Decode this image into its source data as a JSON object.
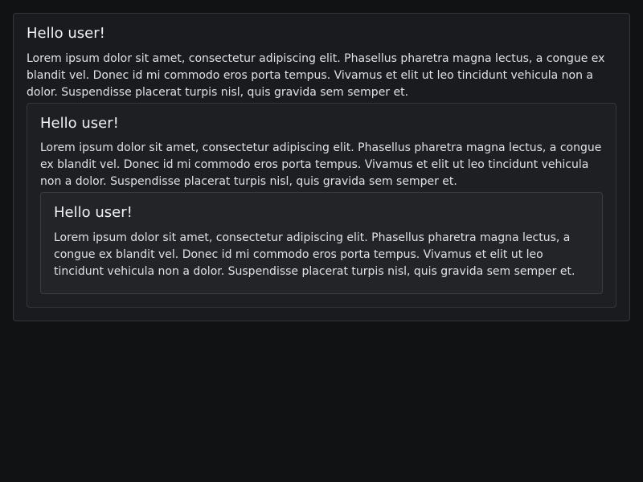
{
  "cards": [
    {
      "title": "Hello user!",
      "text": "Lorem ipsum dolor sit amet, consectetur adipiscing elit. Phasellus pharetra magna lectus, a congue ex blandit vel. Donec id mi commodo eros porta tempus. Vivamus et elit ut leo tincidunt vehicula non a dolor. Suspendisse placerat turpis nisl, quis gravida sem semper et."
    },
    {
      "title": "Hello user!",
      "text": "Lorem ipsum dolor sit amet, consectetur adipiscing elit. Phasellus pharetra magna lectus, a congue ex blandit vel. Donec id mi commodo eros porta tempus. Vivamus et elit ut leo tincidunt vehicula non a dolor. Suspendisse placerat turpis nisl, quis gravida sem semper et."
    },
    {
      "title": "Hello user!",
      "text": "Lorem ipsum dolor sit amet, consectetur adipiscing elit. Phasellus pharetra magna lectus, a congue ex blandit vel. Donec id mi commodo eros porta tempus. Vivamus et elit ut leo tincidunt vehicula non a dolor. Suspendisse placerat turpis nisl, quis gravida sem semper et."
    }
  ]
}
